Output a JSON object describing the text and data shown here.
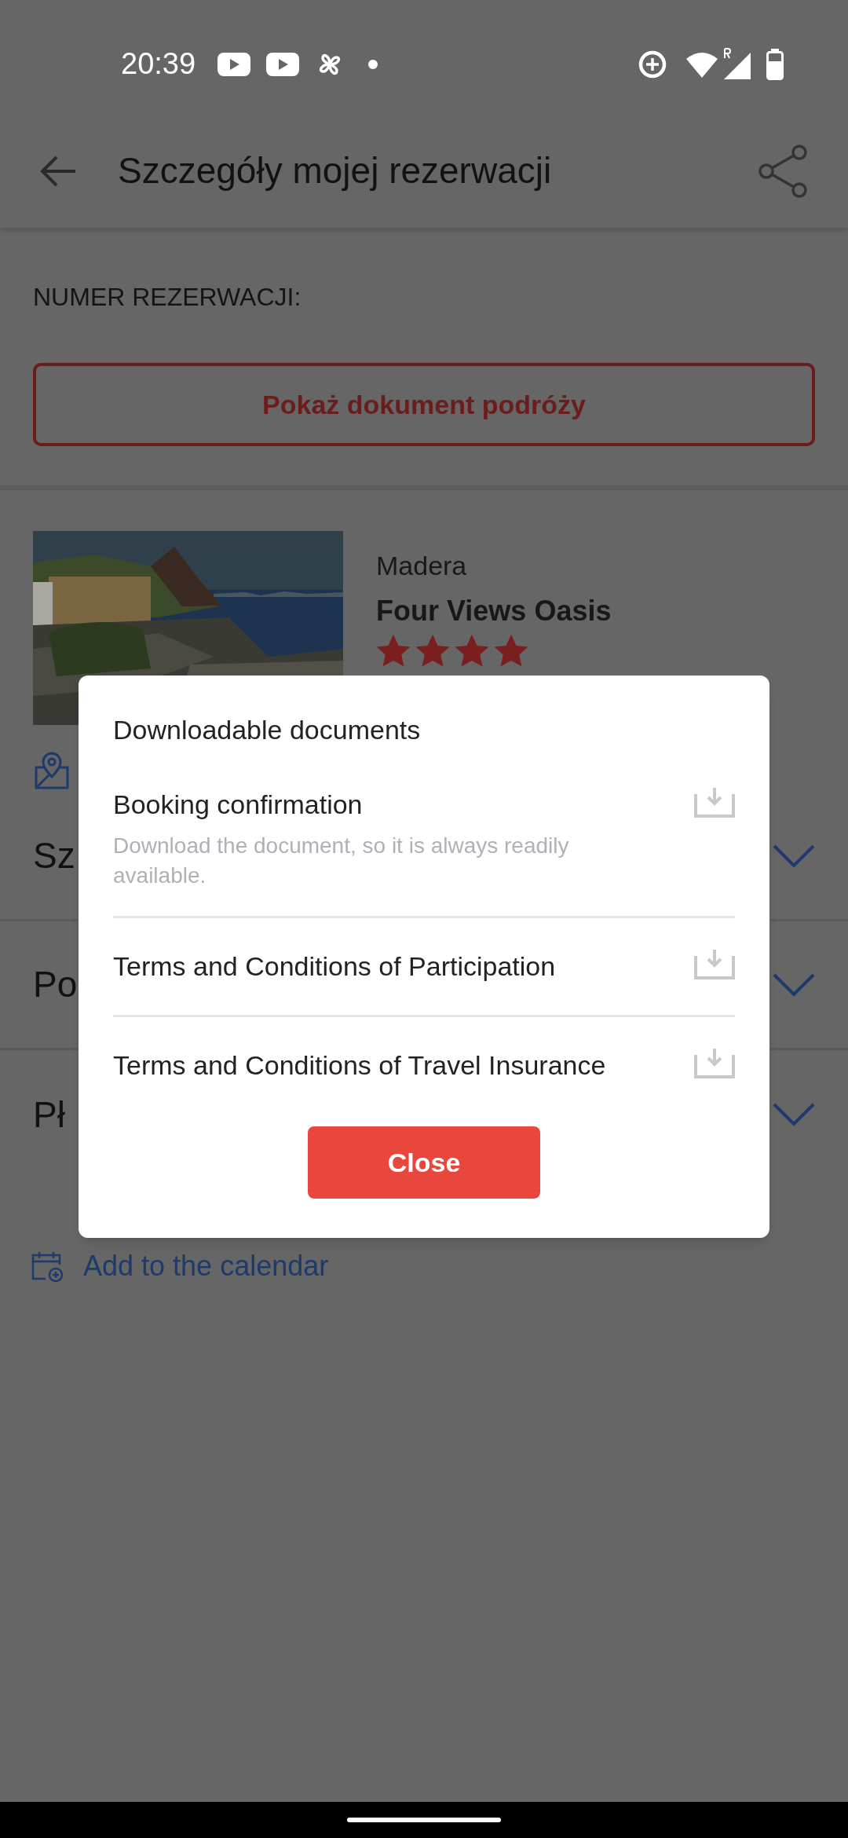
{
  "status_bar": {
    "time": "20:39"
  },
  "app_bar": {
    "title": "Szczegóły mojej rezerwacji"
  },
  "booking_number_label": "NUMER REZERWACJI:",
  "travel_document_button": "Pokaż dokument podróży",
  "hotel": {
    "region": "Madera",
    "name": "Four Views Oasis",
    "stars": 4
  },
  "sections": [
    {
      "label": "Sz"
    },
    {
      "label": "Po"
    },
    {
      "label": "Pł"
    }
  ],
  "calendar_link": "Add to the calendar",
  "dialog": {
    "title": "Downloadable documents",
    "documents": [
      {
        "title": "Booking confirmation",
        "description": "Download the document, so it is always readily available."
      },
      {
        "title": "Terms and Conditions of Participation"
      },
      {
        "title": "Terms and Conditions of Travel Insurance"
      }
    ],
    "close_button": "Close"
  }
}
